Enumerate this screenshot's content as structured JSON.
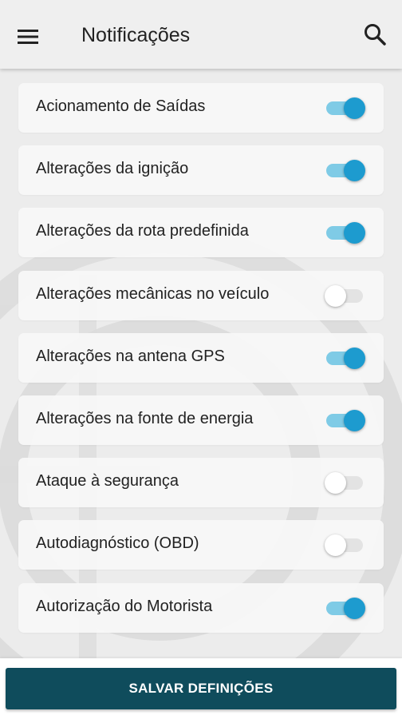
{
  "app_bar": {
    "title": "Notificações",
    "menu_icon": "menu-icon",
    "search_icon": "search-icon"
  },
  "colors": {
    "accent": "#1d9bcf",
    "accent_track": "#7fcbe6",
    "primary_button": "#0f4c5c"
  },
  "notifications": [
    {
      "label": "Acionamento de Saídas",
      "enabled": true
    },
    {
      "label": "Alterações da ignição",
      "enabled": true
    },
    {
      "label": "Alterações da rota predefinida",
      "enabled": true
    },
    {
      "label": "Alterações mecânicas no veículo",
      "enabled": false
    },
    {
      "label": "Alterações na antena GPS",
      "enabled": true
    },
    {
      "label": "Alterações na fonte de energia",
      "enabled": true
    },
    {
      "label": "Ataque à segurança",
      "enabled": false
    },
    {
      "label": "Autodiagnóstico (OBD)",
      "enabled": false
    },
    {
      "label": "Autorização do Motorista",
      "enabled": true
    }
  ],
  "footer": {
    "save_label": "SALVAR DEFINIÇÕES"
  }
}
